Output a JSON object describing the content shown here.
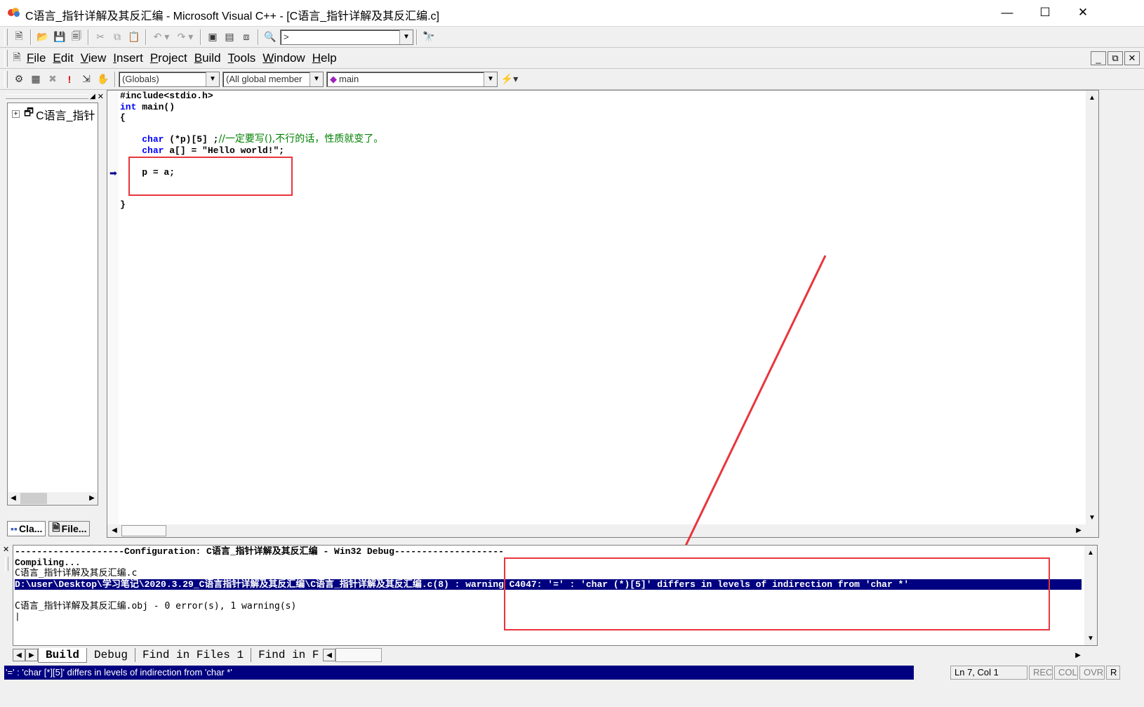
{
  "window": {
    "title": "C语言_指针详解及其反汇编 - Microsoft Visual C++ - [C语言_指针详解及其反汇编.c]",
    "minimize": "—",
    "maximize": "☐",
    "close": "✕"
  },
  "toolbar": {
    "find_combo_value": ">"
  },
  "menu": {
    "items": [
      {
        "u": "F",
        "rest": "ile"
      },
      {
        "u": "E",
        "rest": "dit"
      },
      {
        "u": "V",
        "rest": "iew"
      },
      {
        "u": "I",
        "rest": "nsert"
      },
      {
        "u": "P",
        "rest": "roject"
      },
      {
        "u": "B",
        "rest": "uild"
      },
      {
        "u": "T",
        "rest": "ools"
      },
      {
        "u": "W",
        "rest": "indow"
      },
      {
        "u": "H",
        "rest": "elp"
      }
    ]
  },
  "wizardbar": {
    "scope": "(Globals)",
    "filter": "(All global member",
    "member": "main"
  },
  "workspace": {
    "tree_root": "C语言_指针",
    "tab_class": "Cla...",
    "tab_file": "File..."
  },
  "editor": {
    "include_line": "#include<stdio.h>",
    "int_kw": "int",
    "main_sig": " main()",
    "open_brace": "{",
    "char_kw": "char",
    "line5_code": " (*p)[5] ;",
    "line5_comment": "//一定要写(),不行的话，性质就变了。",
    "line6_code": " a[] = \"Hello world!\";",
    "line8": "p = a;",
    "close_brace": "}"
  },
  "output": {
    "line1": "--------------------Configuration: C语言_指针详解及其反汇编 - Win32 Debug--------------------",
    "line2": "Compiling...",
    "line3": "C语言_指针详解及其反汇编.c",
    "line4": "D:\\user\\Desktop\\学习笔记\\2020.3.29_C语言指针详解及其反汇编\\C语言_指针详解及其反汇编.c(8) : warning C4047: '=' : 'char (*)[5]' differs in levels of indirection from 'char *'",
    "line6": "C语言_指针详解及其反汇编.obj - 0 error(s), 1 warning(s)",
    "tabs": [
      "Build",
      "Debug",
      "Find in Files 1",
      "Find in F"
    ]
  },
  "status": {
    "message": "'=' : 'char [*][5]' differs in levels of indirection from 'char *'",
    "position": "Ln 7, Col 1",
    "rec": "REC",
    "col": "COL",
    "ovr": "OVR",
    "read": "R"
  },
  "colors": {
    "keyword": "#0000ff",
    "comment": "#008000",
    "selection": "#000080",
    "annotation": "#e8363c"
  }
}
